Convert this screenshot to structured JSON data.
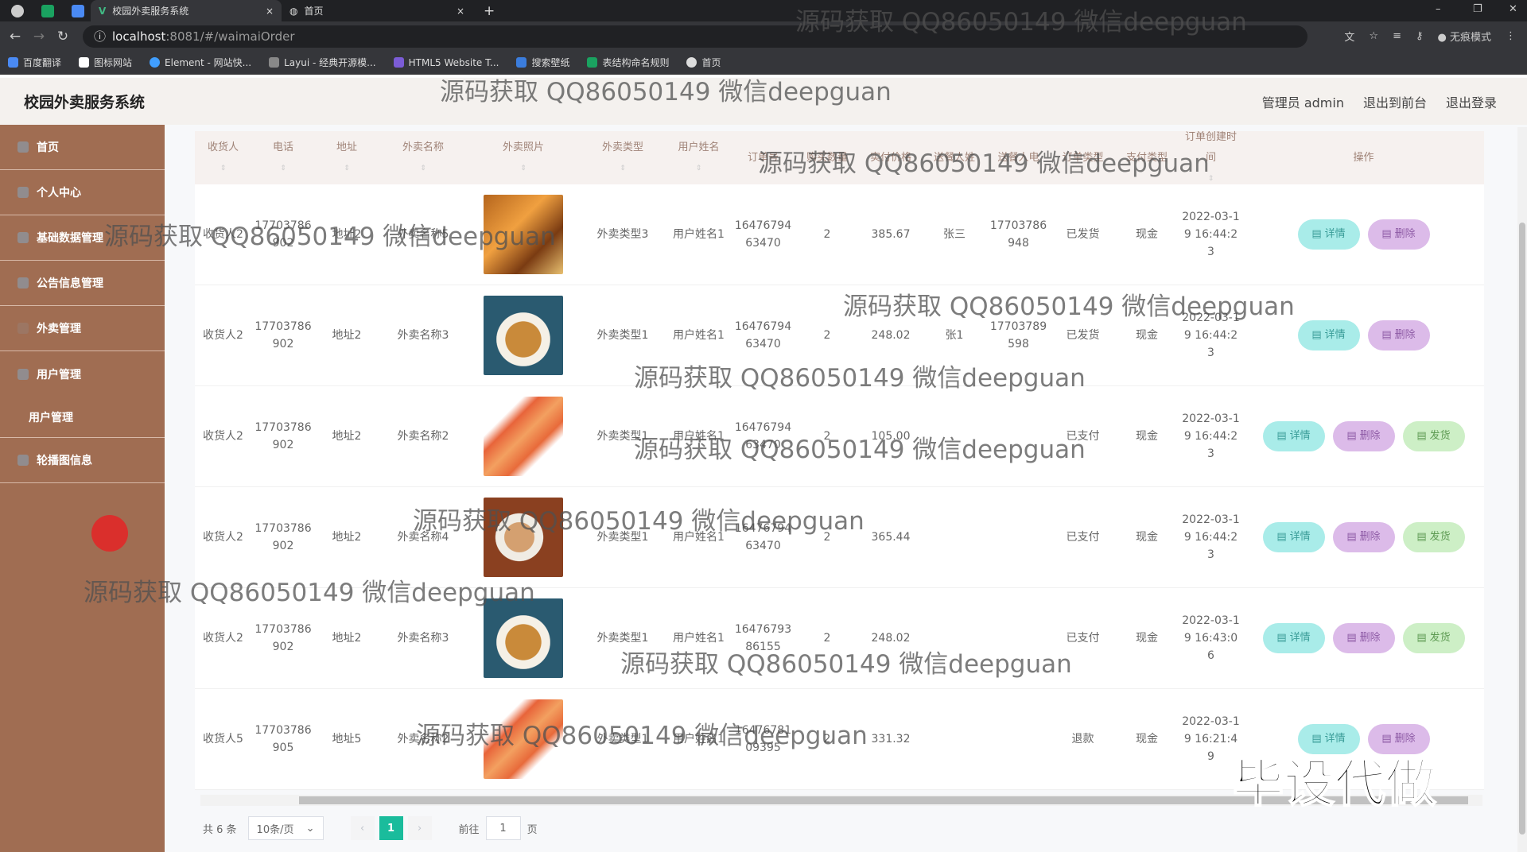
{
  "browser": {
    "tabs": [
      {
        "label": "校园外卖服务系统",
        "active": true
      },
      {
        "label": "首页",
        "active": false
      }
    ],
    "url_host": "localhost",
    "url_path": ":8081/#/waimaiOrder",
    "incognito_label": "无痕模式",
    "bookmarks": [
      "百度翻译",
      "图标网站",
      "Element - 网站快...",
      "Layui - 经典开源模...",
      "HTML5 Website T...",
      "搜索壁纸",
      "表结构命名规则",
      "首页"
    ]
  },
  "header": {
    "title": "校园外卖服务系统",
    "user": "管理员 admin",
    "to_front": "退出到前台",
    "logout": "退出登录"
  },
  "sidebar": {
    "items": [
      {
        "label": "首页"
      },
      {
        "label": "个人中心"
      },
      {
        "label": "基础数据管理"
      },
      {
        "label": "公告信息管理"
      },
      {
        "label": "外卖管理"
      },
      {
        "label": "用户管理"
      },
      {
        "label": "用户管理",
        "sub": true
      },
      {
        "label": "轮播图信息"
      }
    ]
  },
  "table": {
    "columns": [
      "收货人",
      "电话",
      "地址",
      "外卖名称",
      "外卖照片",
      "外卖类型",
      "用户姓名",
      "订单号",
      "购买数量",
      "实付价格",
      "送餐人姓",
      "送餐人电",
      "订单类型",
      "支付类型",
      "订单创建时间",
      "操作"
    ],
    "rows": [
      {
        "receiver": "收货人2",
        "phone": "17703786902",
        "address": "地址2",
        "name": "外卖名称5",
        "type": "外卖类型3",
        "user": "用户姓名1",
        "order_no": "1647679463470",
        "qty": "2",
        "price": "385.67",
        "courier": "张三",
        "courier_phone": "17703786948",
        "order_type": "已发货",
        "pay_type": "现金",
        "created": "2022-03-19 16:44:23",
        "img": "a",
        "actions": [
          "详情",
          "删除"
        ]
      },
      {
        "receiver": "收货人2",
        "phone": "17703786902",
        "address": "地址2",
        "name": "外卖名称3",
        "type": "外卖类型1",
        "user": "用户姓名1",
        "order_no": "1647679463470",
        "qty": "2",
        "price": "248.02",
        "courier": "张1",
        "courier_phone": "17703789598",
        "order_type": "已发货",
        "pay_type": "现金",
        "created": "2022-03-19 16:44:23",
        "img": "b",
        "actions": [
          "详情",
          "删除"
        ]
      },
      {
        "receiver": "收货人2",
        "phone": "17703786902",
        "address": "地址2",
        "name": "外卖名称2",
        "type": "外卖类型1",
        "user": "用户姓名1",
        "order_no": "1647679463470",
        "qty": "2",
        "price": "105.00",
        "courier": "",
        "courier_phone": "",
        "order_type": "已支付",
        "pay_type": "现金",
        "created": "2022-03-19 16:44:23",
        "img": "c",
        "actions": [
          "详情",
          "删除",
          "发货"
        ]
      },
      {
        "receiver": "收货人2",
        "phone": "17703786902",
        "address": "地址2",
        "name": "外卖名称4",
        "type": "外卖类型1",
        "user": "用户姓名1",
        "order_no": "1647679463470",
        "qty": "2",
        "price": "365.44",
        "courier": "",
        "courier_phone": "",
        "order_type": "已支付",
        "pay_type": "现金",
        "created": "2022-03-19 16:44:23",
        "img": "d",
        "actions": [
          "详情",
          "删除",
          "发货"
        ]
      },
      {
        "receiver": "收货人2",
        "phone": "17703786902",
        "address": "地址2",
        "name": "外卖名称3",
        "type": "外卖类型1",
        "user": "用户姓名1",
        "order_no": "1647679386155",
        "qty": "2",
        "price": "248.02",
        "courier": "",
        "courier_phone": "",
        "order_type": "已支付",
        "pay_type": "现金",
        "created": "2022-03-19 16:43:06",
        "img": "b",
        "actions": [
          "详情",
          "删除",
          "发货"
        ]
      },
      {
        "receiver": "收货人5",
        "phone": "17703786905",
        "address": "地址5",
        "name": "外卖名称2",
        "type": "外卖类型1",
        "user": "用户姓名1",
        "order_no": "1647678109395",
        "qty": "2",
        "price": "331.32",
        "courier": "",
        "courier_phone": "",
        "order_type": "退款",
        "pay_type": "现金",
        "created": "2022-03-19 16:21:49",
        "img": "c",
        "actions": [
          "详情",
          "删除"
        ]
      }
    ]
  },
  "pagination": {
    "total": "共 6 条",
    "page_size": "10条/页",
    "current": "1",
    "goto_label": "前往",
    "goto_value": "1",
    "page_suffix": "页"
  },
  "watermark": {
    "text": "源码获取 QQ86050149 微信deepguan",
    "big": "毕设代做"
  },
  "colors": {
    "sidebar": "#a06d52",
    "accent": "#1abc9c",
    "detail": "#a9ece9",
    "delete": "#dcbbe9",
    "ship": "#cdefc6"
  }
}
